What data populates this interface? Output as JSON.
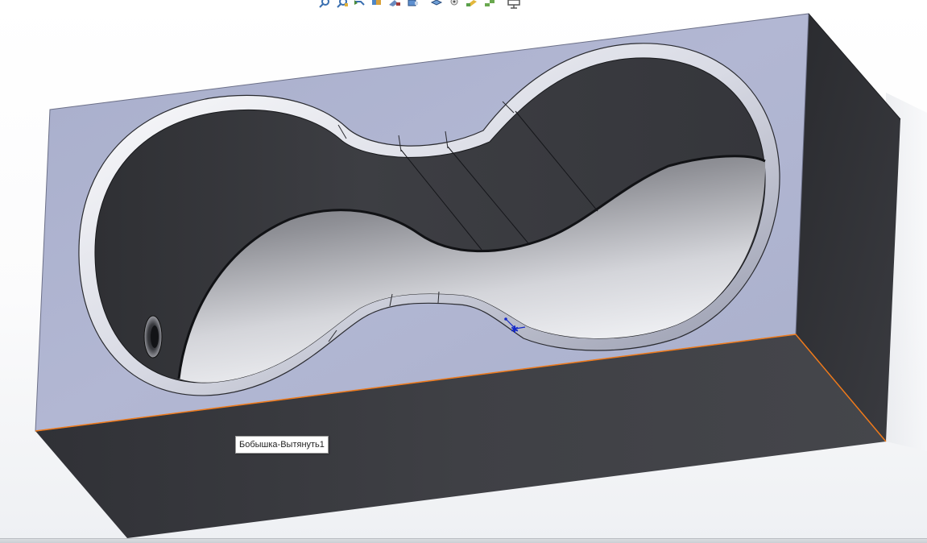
{
  "tooltip": {
    "feature_name": "Бобышка-Вытянуть1"
  },
  "toolbar": {
    "icons": [
      "zoom-to-fit-icon",
      "zoom-to-area-icon",
      "previous-view-icon",
      "section-view-icon",
      "dynamic-annotation-icon",
      "view-orientation-icon",
      "display-style-icon",
      "hide-show-items-icon",
      "edit-appearance-icon",
      "apply-scene-icon",
      "view-settings-icon"
    ]
  },
  "colors": {
    "top_face": "#abb1cf",
    "front_face": "#3b3c41",
    "side_face": "#2e2f33",
    "edge_highlight": "#f07a1a",
    "cavity_dark": "#3a3b40",
    "cavity_light": "#e9eaee",
    "sketch_point": "#1428c8"
  }
}
